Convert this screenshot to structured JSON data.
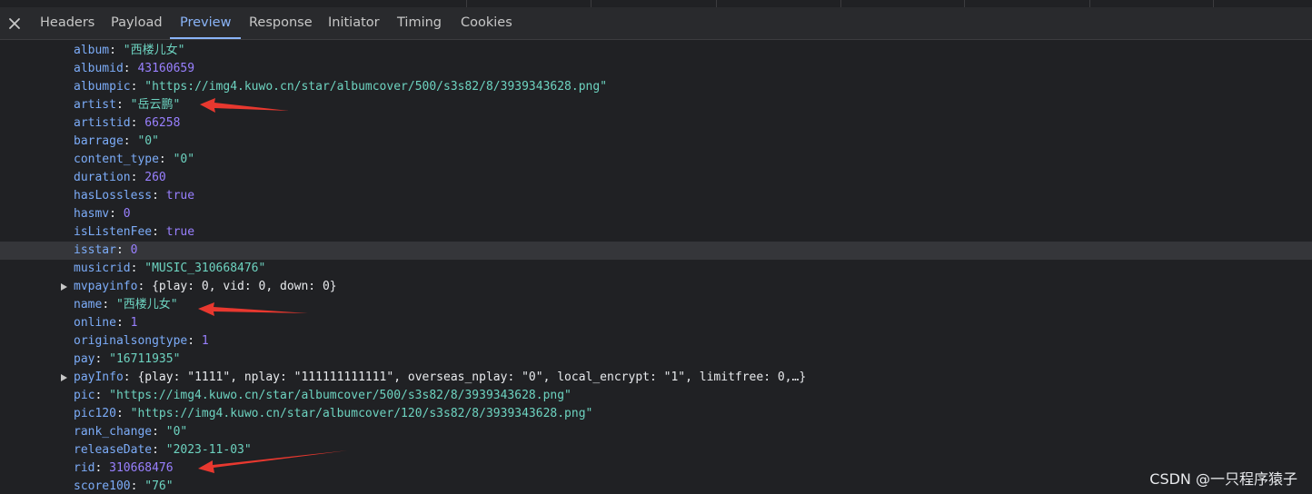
{
  "tabs": [
    {
      "label": "Headers",
      "active": false
    },
    {
      "label": "Payload",
      "active": false
    },
    {
      "label": "Preview",
      "active": true
    },
    {
      "label": "Response",
      "active": false
    },
    {
      "label": "Initiator",
      "active": false
    },
    {
      "label": "Timing",
      "active": false
    },
    {
      "label": "Cookies",
      "active": false
    }
  ],
  "colors": {
    "background": "#202124",
    "key": "#7cacf8",
    "string": "#6dd3c0",
    "number": "#9980ff",
    "active_tab": "#8ab4f8",
    "annotation_arrow": "#e8382f"
  },
  "icons": {
    "close": "close-icon",
    "expand": "triangle-right-icon"
  },
  "preview": {
    "rows": [
      {
        "key": "album",
        "value": "\"西楼儿女\"",
        "type": "string"
      },
      {
        "key": "albumid",
        "value": "43160659",
        "type": "number"
      },
      {
        "key": "albumpic",
        "value": "\"https://img4.kuwo.cn/star/albumcover/500/s3s82/8/3939343628.png\"",
        "type": "string"
      },
      {
        "key": "artist",
        "value": "\"岳云鹏\"",
        "type": "string"
      },
      {
        "key": "artistid",
        "value": "66258",
        "type": "number"
      },
      {
        "key": "barrage",
        "value": "\"0\"",
        "type": "string"
      },
      {
        "key": "content_type",
        "value": "\"0\"",
        "type": "string"
      },
      {
        "key": "duration",
        "value": "260",
        "type": "number"
      },
      {
        "key": "hasLossless",
        "value": "true",
        "type": "bool"
      },
      {
        "key": "hasmv",
        "value": "0",
        "type": "number"
      },
      {
        "key": "isListenFee",
        "value": "true",
        "type": "bool"
      },
      {
        "key": "isstar",
        "value": "0",
        "type": "number",
        "highlighted": true
      },
      {
        "key": "musicrid",
        "value": "\"MUSIC_310668476\"",
        "type": "string"
      },
      {
        "key": "mvpayinfo",
        "value": "{play: 0, vid: 0, down: 0}",
        "type": "object",
        "expandable": true
      },
      {
        "key": "name",
        "value": "\"西楼儿女\"",
        "type": "string"
      },
      {
        "key": "online",
        "value": "1",
        "type": "number"
      },
      {
        "key": "originalsongtype",
        "value": "1",
        "type": "number"
      },
      {
        "key": "pay",
        "value": "\"16711935\"",
        "type": "string"
      },
      {
        "key": "payInfo",
        "value": "{play: \"1111\", nplay: \"111111111111\", overseas_nplay: \"0\", local_encrypt: \"1\", limitfree: 0,…}",
        "type": "object",
        "expandable": true
      },
      {
        "key": "pic",
        "value": "\"https://img4.kuwo.cn/star/albumcover/500/s3s82/8/3939343628.png\"",
        "type": "string"
      },
      {
        "key": "pic120",
        "value": "\"https://img4.kuwo.cn/star/albumcover/120/s3s82/8/3939343628.png\"",
        "type": "string"
      },
      {
        "key": "rank_change",
        "value": "\"0\"",
        "type": "string"
      },
      {
        "key": "releaseDate",
        "value": "\"2023-11-03\"",
        "type": "string"
      },
      {
        "key": "rid",
        "value": "310668476",
        "type": "number"
      },
      {
        "key": "score100",
        "value": "\"76\"",
        "type": "string"
      }
    ]
  },
  "watermark": "CSDN @一只程序猿子"
}
